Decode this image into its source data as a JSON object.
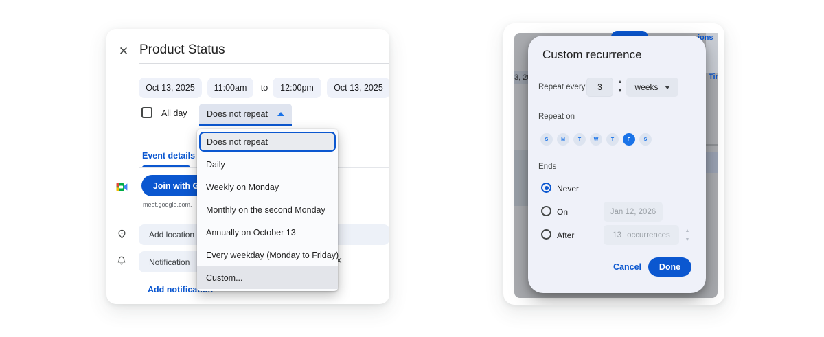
{
  "left_panel": {
    "close_icon": "✕",
    "title": "Product Status",
    "start_date": "Oct 13, 2025",
    "start_time": "11:00am",
    "to_label": "to",
    "end_time": "12:00pm",
    "end_date": "Oct 13, 2025",
    "all_day_label": "All day",
    "recurrence_value": "Does not repeat",
    "tab_label": "Event details",
    "join_button_label": "Join with G",
    "meet_link": "meet.google.com.",
    "location_placeholder": "Add location",
    "notification_value": "Notification",
    "remove_notification_icon": "✕",
    "add_notification_label": "Add notification",
    "recurrence_menu": {
      "items": [
        {
          "label": "Does not repeat",
          "state": "selected"
        },
        {
          "label": "Daily",
          "state": ""
        },
        {
          "label": "Weekly on Monday",
          "state": ""
        },
        {
          "label": "Monthly on the second Monday",
          "state": ""
        },
        {
          "label": "Annually on October 13",
          "state": ""
        },
        {
          "label": "Every weekday (Monday to Friday)",
          "state": ""
        },
        {
          "label": "Custom...",
          "state": "hovered"
        }
      ]
    }
  },
  "right_panel": {
    "backdrop_fragments": {
      "date_fragment": "3, 20",
      "options_fragment": "ions",
      "timezone_fragment": "Tir"
    },
    "dialog": {
      "title": "Custom recurrence",
      "repeat_every_label": "Repeat every",
      "interval_value": "3",
      "spinner_up": "▲",
      "spinner_down": "▼",
      "frequency_value": "weeks",
      "repeat_on_label": "Repeat on",
      "days": [
        {
          "label": "S",
          "state": ""
        },
        {
          "label": "M",
          "state": ""
        },
        {
          "label": "T",
          "state": ""
        },
        {
          "label": "W",
          "state": ""
        },
        {
          "label": "T",
          "state": ""
        },
        {
          "label": "F",
          "state": "selected"
        },
        {
          "label": "S",
          "state": ""
        }
      ],
      "ends_label": "Ends",
      "never_label": "Never",
      "on_label": "On",
      "on_value": "Jan 12, 2026",
      "after_label": "After",
      "after_value": "13",
      "after_suffix": "occurrences",
      "cancel_label": "Cancel",
      "done_label": "Done"
    }
  },
  "colors": {
    "primary_blue": "#0b57d0",
    "day_blue": "#1a73e8",
    "chip_bg": "#eef1f9",
    "dialog_bg": "#eff1f9",
    "backdrop_gray": "#aaacb0"
  }
}
